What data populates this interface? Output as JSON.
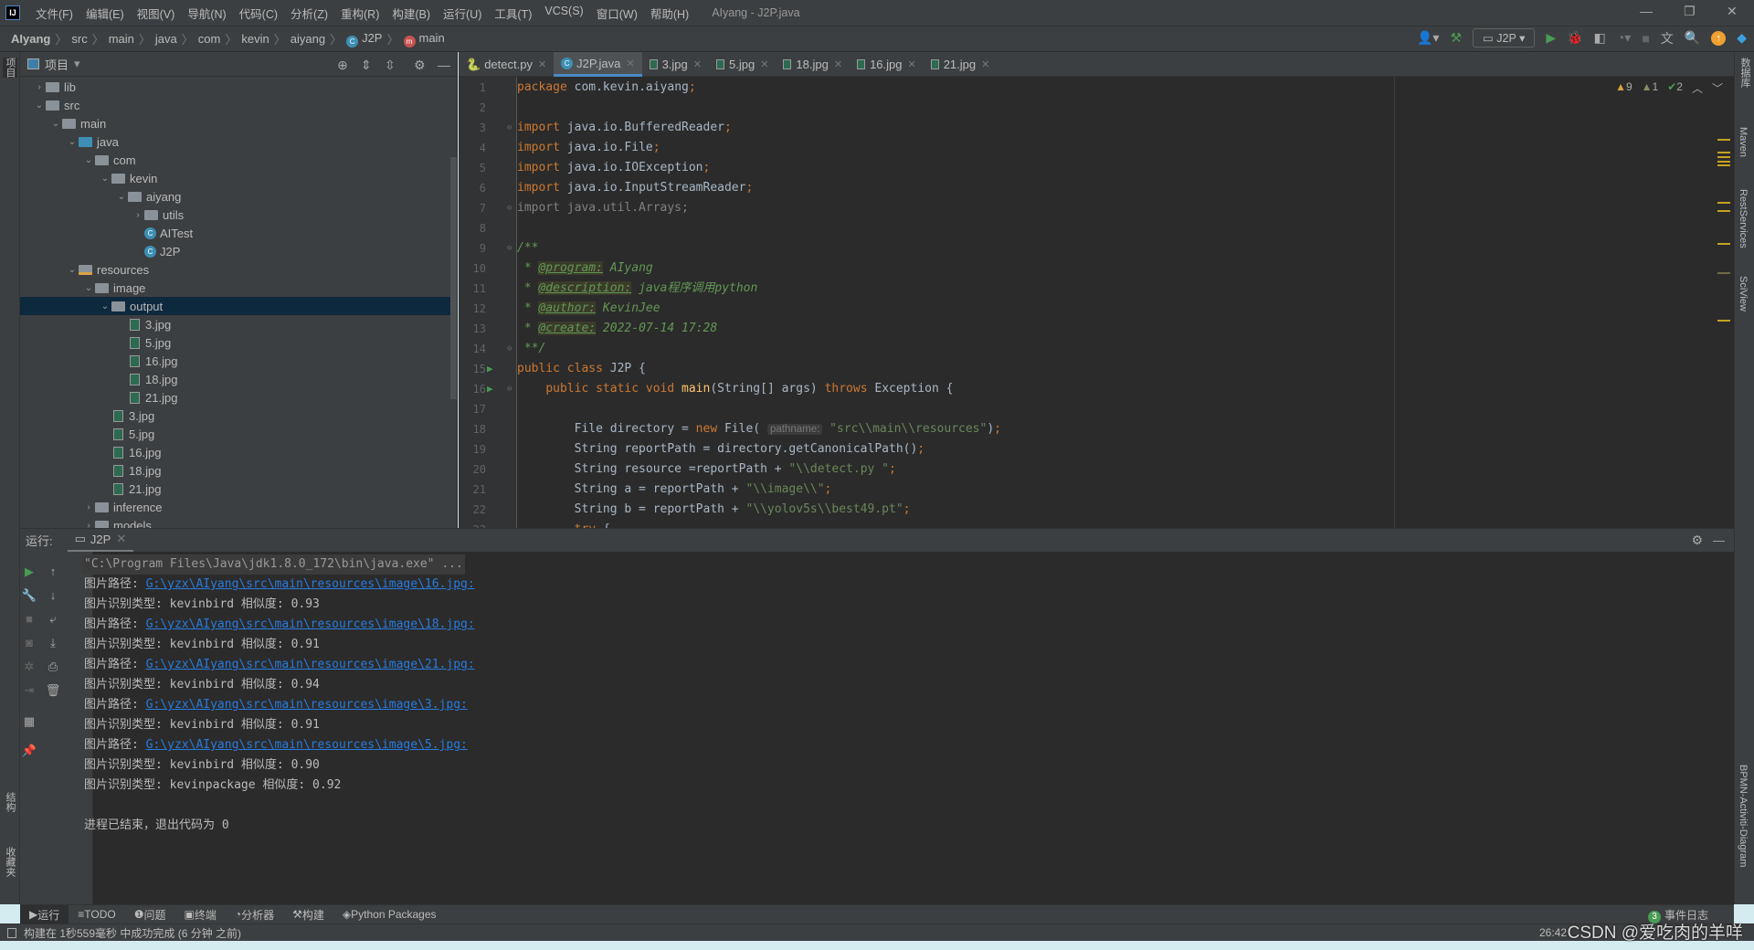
{
  "menubar": {
    "items": [
      "文件(F)",
      "编辑(E)",
      "视图(V)",
      "导航(N)",
      "代码(C)",
      "分析(Z)",
      "重构(R)",
      "构建(B)",
      "运行(U)",
      "工具(T)",
      "VCS(S)",
      "窗口(W)",
      "帮助(H)"
    ],
    "title": "AIyang - J2P.java"
  },
  "breadcrumb": {
    "items": [
      "AIyang",
      "src",
      "main",
      "java",
      "com",
      "kevin",
      "aiyang",
      "J2P",
      "main"
    ]
  },
  "toolbar": {
    "run_config": "J2P"
  },
  "left_strip": {
    "project": "项目",
    "structure": "结构",
    "favorites": "收藏夹"
  },
  "right_strip": [
    "数据库",
    "Maven",
    "RestServices",
    "SciView",
    "BPMN-Activiti-Diagram"
  ],
  "project": {
    "title": "项目",
    "tree": [
      {
        "label": "lib",
        "depth": 0,
        "arrow": "right",
        "icon": "folder"
      },
      {
        "label": "src",
        "depth": 0,
        "arrow": "down",
        "icon": "folder"
      },
      {
        "label": "main",
        "depth": 1,
        "arrow": "down",
        "icon": "folder"
      },
      {
        "label": "java",
        "depth": 2,
        "arrow": "down",
        "icon": "source-folder"
      },
      {
        "label": "com",
        "depth": 3,
        "arrow": "down",
        "icon": "package"
      },
      {
        "label": "kevin",
        "depth": 4,
        "arrow": "down",
        "icon": "package"
      },
      {
        "label": "aiyang",
        "depth": 5,
        "arrow": "down",
        "icon": "package"
      },
      {
        "label": "utils",
        "depth": 6,
        "arrow": "right",
        "icon": "package"
      },
      {
        "label": "AITest",
        "depth": 6,
        "arrow": "",
        "icon": "java-class"
      },
      {
        "label": "J2P",
        "depth": 6,
        "arrow": "",
        "icon": "java-class"
      },
      {
        "label": "resources",
        "depth": 2,
        "arrow": "down",
        "icon": "resources-folder"
      },
      {
        "label": "image",
        "depth": 3,
        "arrow": "down",
        "icon": "folder"
      },
      {
        "label": "output",
        "depth": 4,
        "arrow": "down",
        "icon": "folder",
        "selected": true
      },
      {
        "label": "3.jpg",
        "depth": 5,
        "arrow": "",
        "icon": "image-file"
      },
      {
        "label": "5.jpg",
        "depth": 5,
        "arrow": "",
        "icon": "image-file"
      },
      {
        "label": "16.jpg",
        "depth": 5,
        "arrow": "",
        "icon": "image-file"
      },
      {
        "label": "18.jpg",
        "depth": 5,
        "arrow": "",
        "icon": "image-file"
      },
      {
        "label": "21.jpg",
        "depth": 5,
        "arrow": "",
        "icon": "image-file"
      },
      {
        "label": "3.jpg",
        "depth": 4,
        "arrow": "",
        "icon": "image-file"
      },
      {
        "label": "5.jpg",
        "depth": 4,
        "arrow": "",
        "icon": "image-file"
      },
      {
        "label": "16.jpg",
        "depth": 4,
        "arrow": "",
        "icon": "image-file"
      },
      {
        "label": "18.jpg",
        "depth": 4,
        "arrow": "",
        "icon": "image-file"
      },
      {
        "label": "21.jpg",
        "depth": 4,
        "arrow": "",
        "icon": "image-file"
      },
      {
        "label": "inference",
        "depth": 3,
        "arrow": "right",
        "icon": "folder"
      },
      {
        "label": "models",
        "depth": 3,
        "arrow": "right",
        "icon": "folder"
      }
    ]
  },
  "editor_tabs": [
    {
      "label": "detect.py",
      "icon": "python"
    },
    {
      "label": "J2P.java",
      "icon": "java-class",
      "active": true
    },
    {
      "label": "3.jpg",
      "icon": "image"
    },
    {
      "label": "5.jpg",
      "icon": "image"
    },
    {
      "label": "18.jpg",
      "icon": "image"
    },
    {
      "label": "16.jpg",
      "icon": "image"
    },
    {
      "label": "21.jpg",
      "icon": "image"
    }
  ],
  "inspections": {
    "warnings": "9",
    "weak_warnings": "1",
    "typos": "2"
  },
  "code": [
    {
      "n": "1",
      "t": [
        [
          "kw",
          "package "
        ],
        [
          "pl",
          "com.kevin.aiyang"
        ],
        [
          "kw",
          ";"
        ]
      ]
    },
    {
      "n": "2",
      "t": []
    },
    {
      "n": "3",
      "fold": true,
      "t": [
        [
          "kw",
          "import "
        ],
        [
          "pl",
          "java.io.BufferedReader"
        ],
        [
          "kw",
          ";"
        ]
      ]
    },
    {
      "n": "4",
      "t": [
        [
          "kw",
          "import "
        ],
        [
          "pl",
          "java.io.File"
        ],
        [
          "kw",
          ";"
        ]
      ]
    },
    {
      "n": "5",
      "t": [
        [
          "kw",
          "import "
        ],
        [
          "pl",
          "java.io.IOException"
        ],
        [
          "kw",
          ";"
        ]
      ]
    },
    {
      "n": "6",
      "t": [
        [
          "kw",
          "import "
        ],
        [
          "pl",
          "java.io.InputStreamReader"
        ],
        [
          "kw",
          ";"
        ]
      ]
    },
    {
      "n": "7",
      "fold": true,
      "t": [
        [
          "gray",
          "import java.util.Arrays;"
        ]
      ]
    },
    {
      "n": "8",
      "t": []
    },
    {
      "n": "9",
      "fold": true,
      "t": [
        [
          "cm",
          "/**"
        ]
      ]
    },
    {
      "n": "10",
      "t": [
        [
          "cm",
          " * "
        ],
        [
          "tag",
          "@program:"
        ],
        [
          "cm",
          " AIyang"
        ]
      ]
    },
    {
      "n": "11",
      "t": [
        [
          "cm",
          " * "
        ],
        [
          "tag",
          "@description:"
        ],
        [
          "cm",
          " java程序调用python"
        ]
      ]
    },
    {
      "n": "12",
      "t": [
        [
          "cm",
          " * "
        ],
        [
          "tag",
          "@author:"
        ],
        [
          "cm",
          " KevinJee"
        ]
      ]
    },
    {
      "n": "13",
      "t": [
        [
          "cm",
          " * "
        ],
        [
          "tag",
          "@create:"
        ],
        [
          "cm",
          " 2022-07-14 17:28"
        ]
      ]
    },
    {
      "n": "14",
      "fold": true,
      "t": [
        [
          "cm",
          " **/"
        ]
      ]
    },
    {
      "n": "15",
      "run": true,
      "t": [
        [
          "kw",
          "public class "
        ],
        [
          "pl",
          "J2P {"
        ]
      ]
    },
    {
      "n": "16",
      "run": true,
      "fold": true,
      "t": [
        [
          "pl",
          "    "
        ],
        [
          "kw",
          "public static void "
        ],
        [
          "fn",
          "main"
        ],
        [
          "pl",
          "(String[] args) "
        ],
        [
          "kw",
          "throws "
        ],
        [
          "pl",
          "Exception {"
        ]
      ]
    },
    {
      "n": "17",
      "t": []
    },
    {
      "n": "18",
      "t": [
        [
          "pl",
          "        File directory = "
        ],
        [
          "kw",
          "new "
        ],
        [
          "pl",
          "File( "
        ],
        [
          "hint",
          "pathname:"
        ],
        [
          "str",
          " \"src\\\\main\\\\resources\""
        ],
        [
          "pl",
          ")"
        ],
        [
          "kw",
          ";"
        ]
      ]
    },
    {
      "n": "19",
      "t": [
        [
          "pl",
          "        String reportPath = directory.getCanonicalPath()"
        ],
        [
          "kw",
          ";"
        ]
      ]
    },
    {
      "n": "20",
      "t": [
        [
          "pl",
          "        String resource =reportPath + "
        ],
        [
          "str",
          "\"\\\\detect.py \""
        ],
        [
          "kw",
          ";"
        ]
      ]
    },
    {
      "n": "21",
      "t": [
        [
          "pl",
          "        String a = reportPath + "
        ],
        [
          "str",
          "\"\\\\image\\\\\""
        ],
        [
          "kw",
          ";"
        ]
      ]
    },
    {
      "n": "22",
      "t": [
        [
          "pl",
          "        String b = reportPath + "
        ],
        [
          "str",
          "\"\\\\yolov5s\\\\best49.pt\""
        ],
        [
          "kw",
          ";"
        ]
      ]
    },
    {
      "n": "23",
      "t": [
        [
          "pl",
          "        "
        ],
        [
          "kw",
          "try "
        ],
        [
          "pl",
          "{"
        ]
      ]
    }
  ],
  "run": {
    "label": "运行:",
    "tab": "J2P",
    "lines": [
      {
        "type": "cmd",
        "text": "\"C:\\Program Files\\Java\\jdk1.8.0_172\\bin\\java.exe\" ..."
      },
      {
        "prefix": "图片路径: ",
        "link": "G:\\yzx\\AIyang\\src\\main\\resources\\image\\16.jpg:"
      },
      {
        "text": "图片识别类型: kevinbird 相似度: 0.93"
      },
      {
        "prefix": "图片路径: ",
        "link": "G:\\yzx\\AIyang\\src\\main\\resources\\image\\18.jpg:"
      },
      {
        "text": "图片识别类型: kevinbird 相似度: 0.91"
      },
      {
        "prefix": "图片路径: ",
        "link": "G:\\yzx\\AIyang\\src\\main\\resources\\image\\21.jpg:"
      },
      {
        "text": "图片识别类型: kevinbird 相似度: 0.94"
      },
      {
        "prefix": "图片路径: ",
        "link": "G:\\yzx\\AIyang\\src\\main\\resources\\image\\3.jpg:"
      },
      {
        "text": "图片识别类型: kevinbird 相似度: 0.91"
      },
      {
        "prefix": "图片路径: ",
        "link": "G:\\yzx\\AIyang\\src\\main\\resources\\image\\5.jpg:"
      },
      {
        "text": "图片识别类型: kevinbird 相似度: 0.90"
      },
      {
        "text": "图片识别类型: kevinpackage 相似度: 0.92"
      },
      {
        "text": ""
      },
      {
        "text": "进程已结束，退出代码为 0"
      }
    ]
  },
  "bottom_tabs": [
    "运行",
    "TODO",
    "问题",
    "终端",
    "分析器",
    "构建",
    "Python Packages"
  ],
  "event_log": {
    "count": "3",
    "label": "事件日志"
  },
  "status": {
    "message": "构建在 1秒559毫秒 中成功完成 (6 分钟 之前)",
    "position": "26:42"
  },
  "watermark": "CSDN @爱吃肉的羊咩",
  "colors": {
    "accent": "#4a88c7",
    "editor_bg": "#2b2b2b",
    "panel_bg": "#3c3f41",
    "selection": "#0d293e",
    "link": "#287bde"
  }
}
